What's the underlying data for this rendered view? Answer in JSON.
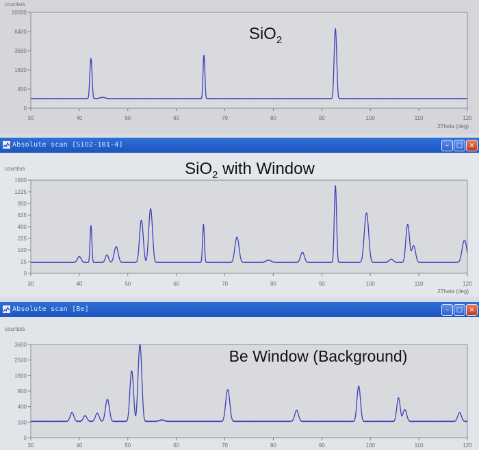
{
  "colors": {
    "trace": "#3b3fb8",
    "plot_bg": "#d9dade",
    "titlebar": "#1f5bc4"
  },
  "windows": [
    {
      "title": "",
      "window_buttons": []
    },
    {
      "title": "Absolute scan [SiO2-101-4]",
      "window_buttons": [
        "minimize",
        "maximize",
        "close"
      ]
    },
    {
      "title": "Absolute scan [Be]",
      "window_buttons": [
        "minimize",
        "maximize",
        "close"
      ]
    }
  ],
  "chart_data": [
    {
      "type": "line",
      "title": "SiO",
      "title_subscript": "2",
      "title_suffix": "",
      "ylabel": "counts/s",
      "xlabel": "2Theta (deg)",
      "xlim": [
        30,
        120
      ],
      "x_ticks": [
        30,
        40,
        50,
        60,
        70,
        80,
        90,
        100,
        110,
        120
      ],
      "y_ticks": [
        "0",
        "400",
        "1600",
        "3600",
        "6400",
        "10000"
      ],
      "y_tick_values": [
        0,
        400,
        1600,
        3600,
        6400,
        10000
      ],
      "y_scale": "sqrt",
      "baseline": 100,
      "peaks": [
        {
          "x": 42.4,
          "y": 2600,
          "w": 0.18
        },
        {
          "x": 44.8,
          "y": 30,
          "w": 0.5
        },
        {
          "x": 65.7,
          "y": 3000,
          "w": 0.15
        },
        {
          "x": 92.8,
          "y": 6800,
          "w": 0.2
        }
      ]
    },
    {
      "type": "line",
      "title": "SiO",
      "title_subscript": "2",
      "title_suffix": " with Window",
      "ylabel": "counts/s",
      "xlabel": "2Theta (deg)",
      "xlim": [
        30,
        120
      ],
      "x_ticks": [
        30,
        40,
        50,
        60,
        70,
        80,
        90,
        100,
        110,
        120
      ],
      "y_ticks": [
        "0",
        "25",
        "100",
        "225",
        "400",
        "625",
        "900",
        "1225",
        "1600"
      ],
      "y_tick_values": [
        0,
        25,
        100,
        225,
        400,
        625,
        900,
        1225,
        1600
      ],
      "y_scale": "sqrt",
      "baseline": 22,
      "peaks": [
        {
          "x": 40.0,
          "y": 30,
          "w": 0.35
        },
        {
          "x": 42.4,
          "y": 400,
          "w": 0.15
        },
        {
          "x": 45.7,
          "y": 40,
          "w": 0.3
        },
        {
          "x": 47.6,
          "y": 110,
          "w": 0.35
        },
        {
          "x": 52.8,
          "y": 500,
          "w": 0.3
        },
        {
          "x": 54.7,
          "y": 750,
          "w": 0.3
        },
        {
          "x": 65.6,
          "y": 420,
          "w": 0.15
        },
        {
          "x": 72.5,
          "y": 220,
          "w": 0.35
        },
        {
          "x": 79.0,
          "y": 10,
          "w": 0.5
        },
        {
          "x": 86.0,
          "y": 60,
          "w": 0.35
        },
        {
          "x": 92.8,
          "y": 1400,
          "w": 0.18
        },
        {
          "x": 99.2,
          "y": 650,
          "w": 0.35
        },
        {
          "x": 104.3,
          "y": 15,
          "w": 0.4
        },
        {
          "x": 107.7,
          "y": 420,
          "w": 0.3
        },
        {
          "x": 108.9,
          "y": 120,
          "w": 0.35
        },
        {
          "x": 119.4,
          "y": 180,
          "w": 0.4
        }
      ]
    },
    {
      "type": "line",
      "title": "Be Window (Background)",
      "title_subscript": "",
      "title_suffix": "",
      "ylabel": "counts/s",
      "xlabel": "",
      "xlim": [
        30,
        120
      ],
      "x_ticks": [
        30,
        40,
        50,
        60,
        70,
        80,
        90,
        100,
        110,
        120
      ],
      "y_ticks": [
        "0",
        "100",
        "400",
        "900",
        "1600",
        "2500",
        "3600"
      ],
      "y_tick_values": [
        0,
        100,
        400,
        900,
        1600,
        2500,
        3600
      ],
      "y_scale": "sqrt",
      "baseline": 110,
      "peaks": [
        {
          "x": 38.5,
          "y": 150,
          "w": 0.35
        },
        {
          "x": 41.2,
          "y": 90,
          "w": 0.35
        },
        {
          "x": 43.7,
          "y": 140,
          "w": 0.35
        },
        {
          "x": 45.8,
          "y": 500,
          "w": 0.35
        },
        {
          "x": 50.8,
          "y": 1750,
          "w": 0.3
        },
        {
          "x": 52.5,
          "y": 3500,
          "w": 0.3
        },
        {
          "x": 57.0,
          "y": 20,
          "w": 0.5
        },
        {
          "x": 70.6,
          "y": 850,
          "w": 0.35
        },
        {
          "x": 84.8,
          "y": 200,
          "w": 0.35
        },
        {
          "x": 97.6,
          "y": 1000,
          "w": 0.3
        },
        {
          "x": 105.8,
          "y": 550,
          "w": 0.3
        },
        {
          "x": 107.1,
          "y": 220,
          "w": 0.35
        },
        {
          "x": 118.4,
          "y": 150,
          "w": 0.35
        }
      ]
    }
  ]
}
